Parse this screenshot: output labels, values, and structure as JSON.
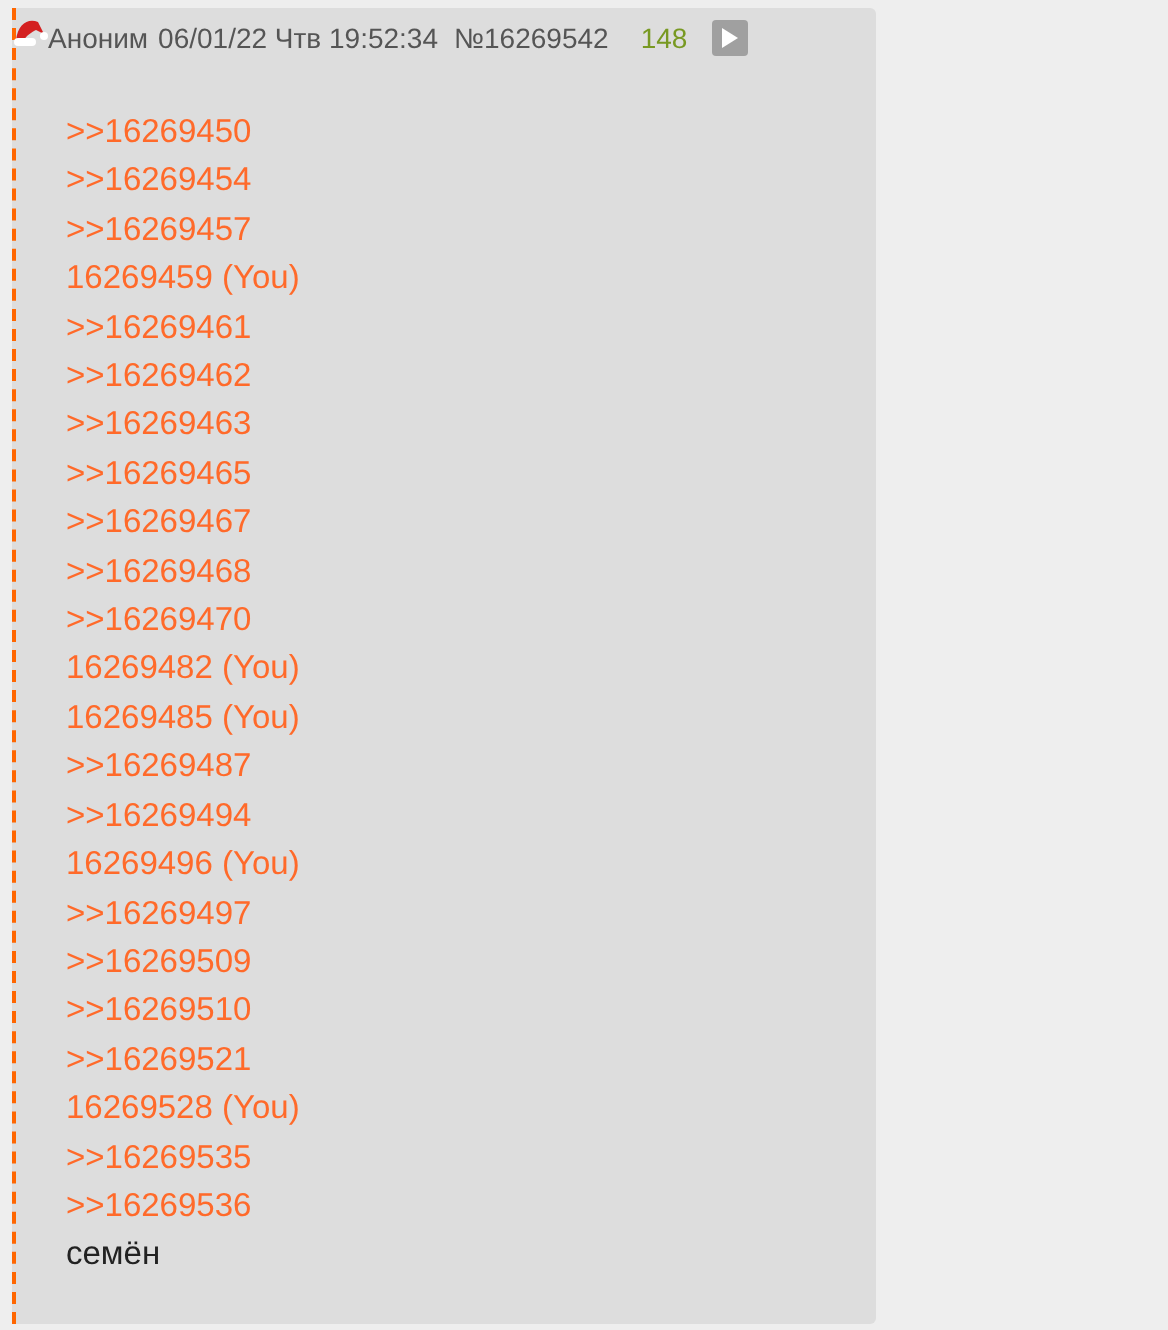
{
  "post": {
    "author": "Аноним",
    "date": "06/01/22 Чтв 19:52:34",
    "number": "№16269542",
    "count": "148",
    "links": [
      ">>16269450",
      ">>16269454",
      ">>16269457",
      "16269459 (You)",
      ">>16269461",
      ">>16269462",
      ">>16269463",
      ">>16269465",
      ">>16269467",
      ">>16269468",
      ">>16269470",
      "16269482 (You)",
      "16269485 (You)",
      ">>16269487",
      ">>16269494",
      "16269496 (You)",
      ">>16269497",
      ">>16269509",
      ">>16269510",
      ">>16269521",
      "16269528 (You)",
      ">>16269535",
      ">>16269536"
    ],
    "message": "семён"
  }
}
